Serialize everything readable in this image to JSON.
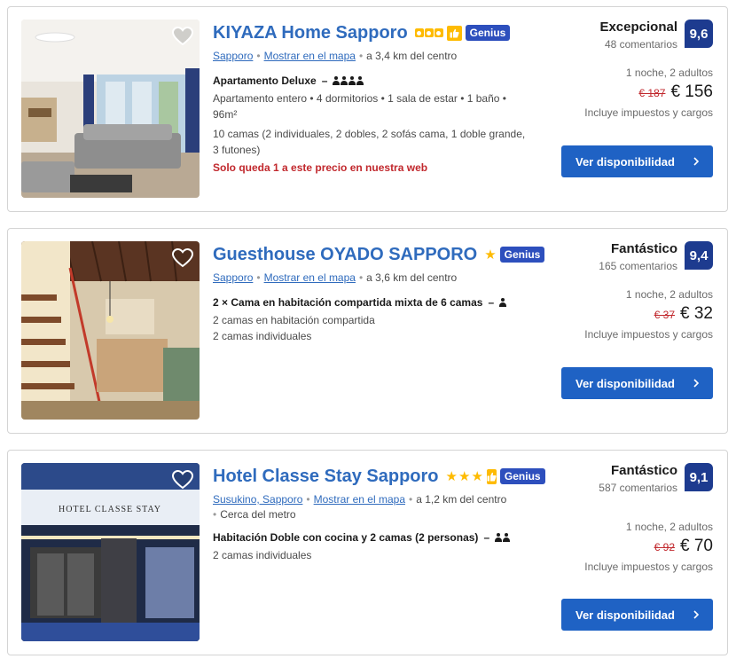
{
  "listings": [
    {
      "name": "KIYAZA Home Sapporo",
      "rating_type": "squares",
      "rating_count": 3,
      "preferred": true,
      "genius_label": "Genius",
      "location_parts": [
        "Sapporo",
        "Mostrar en el mapa"
      ],
      "distance": "a 3,4 km del centro",
      "extra_location": "",
      "room_name": "Apartamento Deluxe",
      "room_occupancy": 4,
      "details": [
        "Apartamento entero  • 4 dormitorios • 1 sala de estar • 1 baño • 96m²",
        "10 camas (2 individuales, 2 dobles, 2 sofás cama, 1 doble grande, 3 futones)"
      ],
      "warning": "Solo queda 1 a este precio en nuestra web",
      "score_label": "Excepcional",
      "review_count": "48 comentarios",
      "score": "9,6",
      "nights": "1 noche, 2 adultos",
      "old_price": "€ 187",
      "price": "€ 156",
      "taxes": "Incluye impuestos y cargos",
      "button": "Ver disponibilidad"
    },
    {
      "name": "Guesthouse OYADO SAPPORO",
      "rating_type": "stars",
      "rating_count": 1,
      "preferred": false,
      "genius_label": "Genius",
      "location_parts": [
        "Sapporo",
        "Mostrar en el mapa"
      ],
      "distance": "a 3,6 km del centro",
      "extra_location": "",
      "room_name": "2 × Cama en habitación compartida mixta de 6 camas",
      "room_occupancy": 1,
      "details": [
        "2 camas en habitación compartida",
        "2 camas individuales"
      ],
      "warning": "",
      "score_label": "Fantástico",
      "review_count": "165 comentarios",
      "score": "9,4",
      "nights": "1 noche, 2 adultos",
      "old_price": "€ 37",
      "price": "€ 32",
      "taxes": "Incluye impuestos y cargos",
      "button": "Ver disponibilidad"
    },
    {
      "name": "Hotel Classe Stay Sapporo",
      "rating_type": "stars",
      "rating_count": 3,
      "preferred": true,
      "genius_label": "Genius",
      "location_parts": [
        "Susukino, Sapporo",
        "Mostrar en el mapa"
      ],
      "distance": "a 1,2 km del centro",
      "extra_location": "Cerca del metro",
      "room_name": "Habitación Doble con cocina y 2 camas (2 personas)",
      "room_occupancy": 2,
      "details": [
        "2 camas individuales"
      ],
      "warning": "",
      "score_label": "Fantástico",
      "review_count": "587 comentarios",
      "score": "9,1",
      "nights": "1 noche, 2 adultos",
      "old_price": "€ 92",
      "price": "€ 70",
      "taxes": "Incluye impuestos y cargos",
      "button": "Ver disponibilidad",
      "photo_sign": "HOTEL CLASSE STAY"
    }
  ],
  "colors": {
    "link": "#2f6bbd",
    "genius": "#2d4fbd",
    "score_badge": "#1d3b8f",
    "button": "#1f62c4",
    "warning": "#c1282d",
    "star": "#febb02"
  },
  "icons": {
    "heart": "heart-icon",
    "chevron": "chevron-right-icon",
    "person": "person-icon",
    "thumbs_up": "thumbs-up-icon"
  }
}
